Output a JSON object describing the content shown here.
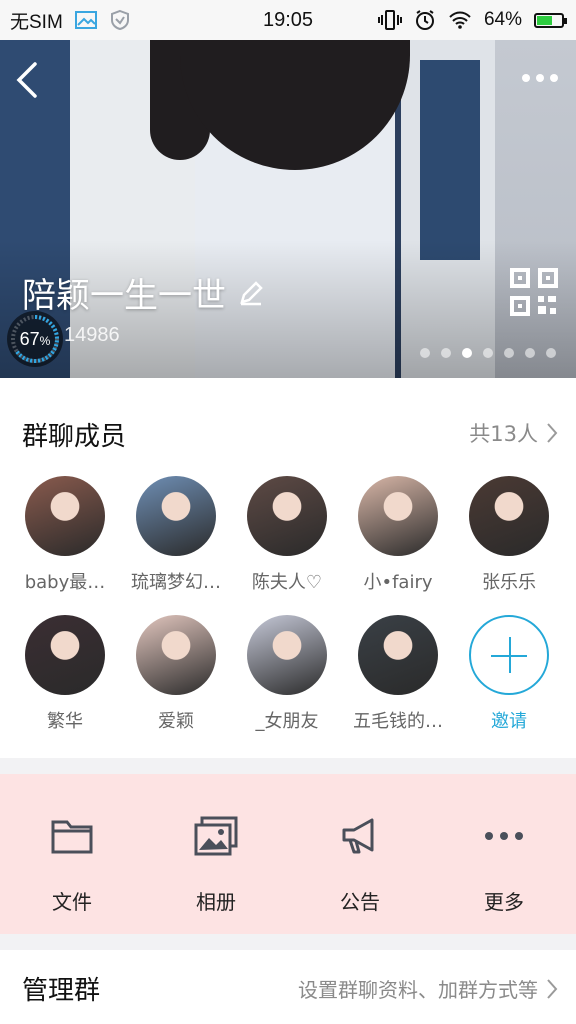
{
  "status_bar": {
    "carrier": "无SIM",
    "time": "19:05",
    "battery_percent": "64%",
    "battery_level": 0.64
  },
  "hero": {
    "group_name": "陪颖一生一世",
    "group_id": "14986",
    "level_value": "67",
    "level_unit": "%",
    "level_fraction": 0.67,
    "page_dots": {
      "count": 7,
      "active_index": 2
    }
  },
  "members": {
    "title": "群聊成员",
    "count_label": "共13人",
    "list": [
      {
        "name": "baby最…",
        "avatar_color": "#8a5b4e"
      },
      {
        "name": "琉璃梦幻…",
        "avatar_color": "#6f8fb5"
      },
      {
        "name": "陈夫人♡",
        "avatar_color": "#5e4a45"
      },
      {
        "name": "小•fairy",
        "avatar_color": "#d9b7a8"
      },
      {
        "name": "张乐乐",
        "avatar_color": "#4b3a34"
      },
      {
        "name": "繁华",
        "avatar_color": "#3b2e33"
      },
      {
        "name": "爱颖",
        "avatar_color": "#e3c7bf"
      },
      {
        "name": "_女朋友",
        "avatar_color": "#c6c9d8"
      },
      {
        "name": "五毛钱的…",
        "avatar_color": "#3a4046"
      }
    ],
    "invite_label": "邀请"
  },
  "actions": [
    {
      "label": "文件",
      "icon": "folder-icon"
    },
    {
      "label": "相册",
      "icon": "photo-album-icon"
    },
    {
      "label": "公告",
      "icon": "megaphone-icon"
    },
    {
      "label": "更多",
      "icon": "more-dots-icon"
    }
  ],
  "manage": {
    "title": "管理群",
    "description": "设置群聊资料、加群方式等"
  },
  "colors": {
    "accent": "#24a8d8",
    "action_bg": "#fde3e3",
    "icon": "#4a4f5a"
  }
}
